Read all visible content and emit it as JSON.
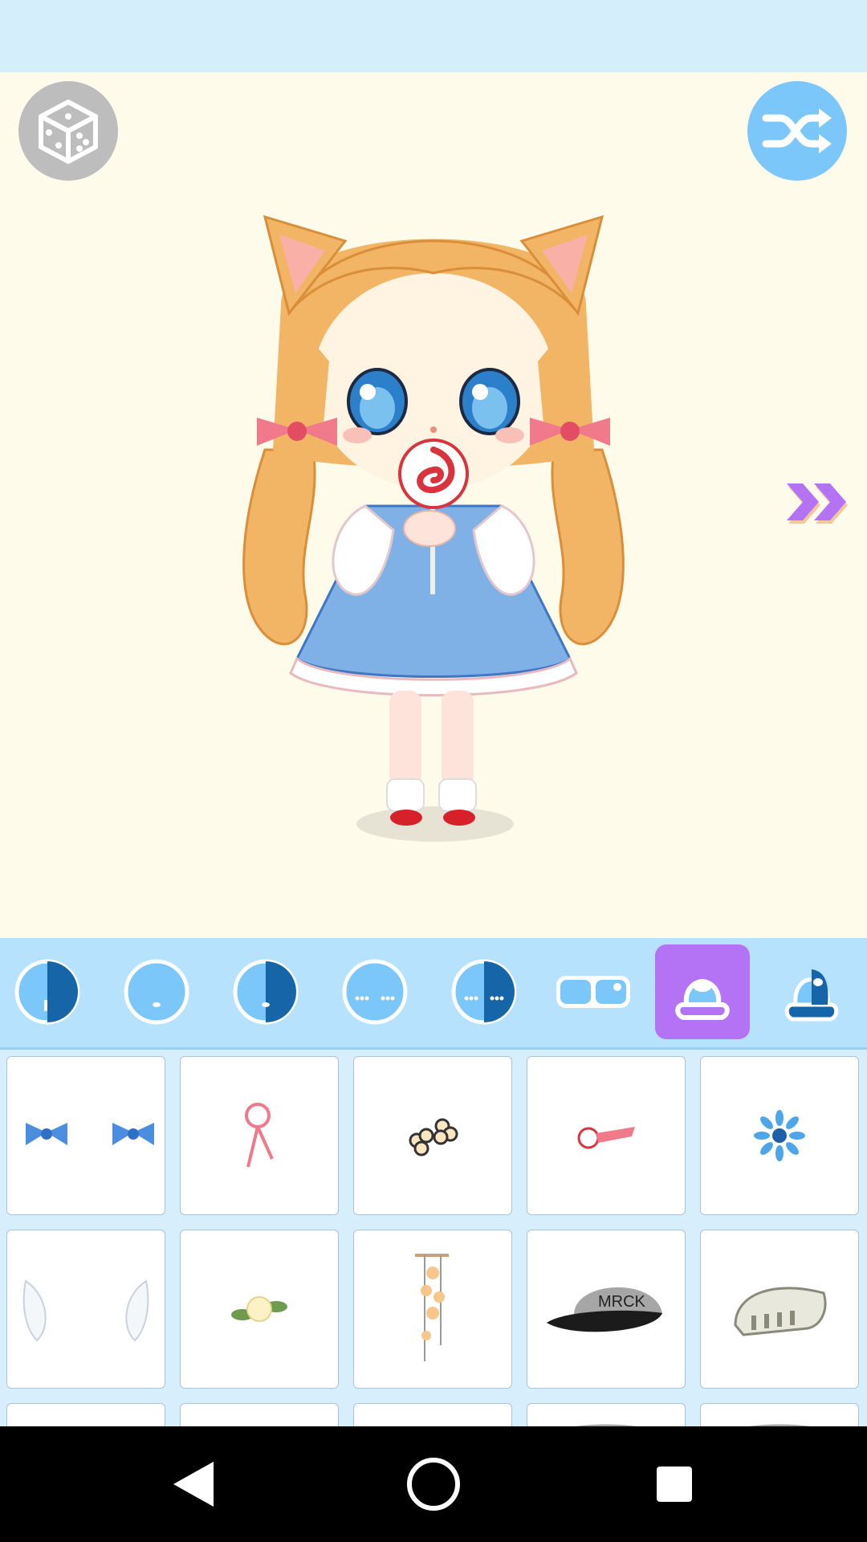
{
  "top_controls": {
    "randomize": {
      "icon": "dice-icon"
    },
    "shuffle": {
      "icon": "shuffle-icon"
    },
    "next": {
      "icon": "double-chevron-right-icon"
    }
  },
  "tabs": [
    {
      "icon": "skin-half-tone-icon",
      "selected": false
    },
    {
      "icon": "face-mouth-icon",
      "selected": false
    },
    {
      "icon": "face-half-mouth-icon",
      "selected": false
    },
    {
      "icon": "face-blush-icon",
      "selected": false
    },
    {
      "icon": "face-half-blush-icon",
      "selected": false
    },
    {
      "icon": "eyes-icon",
      "selected": false
    },
    {
      "icon": "hair-accessory-icon",
      "selected": true
    },
    {
      "icon": "hair-half-icon",
      "selected": false
    }
  ],
  "items": [
    {
      "icon": "blue-gingham-bows-icon"
    },
    {
      "icon": "pink-ribbon-pin-icon"
    },
    {
      "icon": "flower-clips-icon"
    },
    {
      "icon": "apple-hairclip-icon"
    },
    {
      "icon": "blue-daisy-icon"
    },
    {
      "icon": "angel-wings-icon"
    },
    {
      "icon": "cream-rose-icon"
    },
    {
      "icon": "dangling-flower-chain-icon"
    },
    {
      "icon": "cap-icon",
      "text": "MRCK"
    },
    {
      "icon": "skull-headpiece-icon"
    },
    {
      "icon": "item-partial-icon"
    },
    {
      "icon": "item-partial-icon"
    },
    {
      "icon": "item-partial-icon"
    },
    {
      "icon": "grey-cap-partial-icon"
    },
    {
      "icon": "grey-cap-partial-icon"
    }
  ],
  "colors": {
    "status_bar": "#d4eefc",
    "stage_bg": "#fffbea",
    "tab_bar": "#b6e2fd",
    "selected_tab": "#b473f5",
    "grid_bg": "#d7eefd",
    "accent_blue": "#7cc7f9"
  },
  "navigation": {
    "back": {
      "icon": "back-triangle-icon"
    },
    "home": {
      "icon": "home-circle-icon"
    },
    "recents": {
      "icon": "recents-square-icon"
    }
  }
}
